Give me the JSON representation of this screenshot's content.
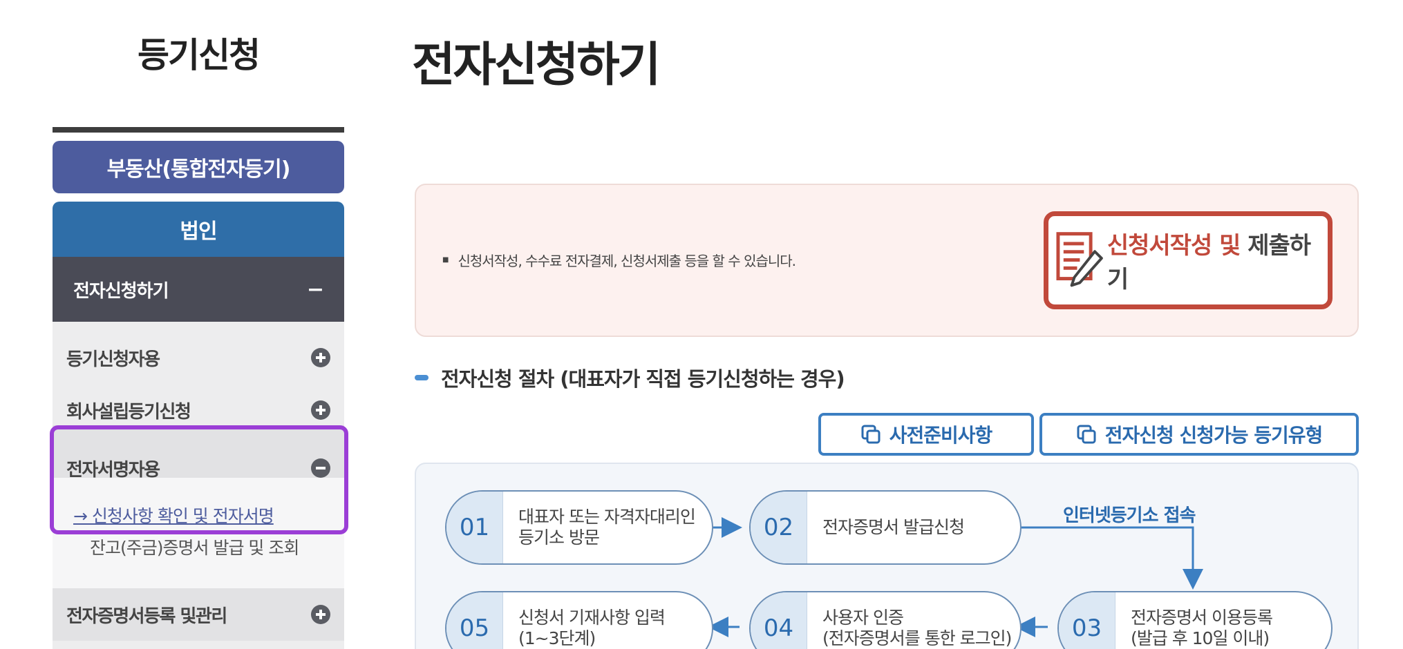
{
  "sidebar": {
    "title": "등기신청",
    "primary_menu": "부동산(통합전자등기)",
    "corp_menu": "법인",
    "active_submenu": "전자신청하기",
    "items": [
      {
        "label": "등기신청자용"
      },
      {
        "label": "회사설립등기신청"
      },
      {
        "label": "전자서명자용"
      },
      {
        "label": "전자증명서등록 및관리"
      }
    ],
    "children": [
      {
        "label": "→ 신청사항 확인 및 전자서명"
      },
      {
        "label": "잔고(주금)증명서 발급 및 조회"
      }
    ]
  },
  "main": {
    "page_title": "전자신청하기",
    "info_text": "신청서작성, 수수료 전자결제, 신청서제출 등을 할 수 있습니다.",
    "apply_button": {
      "part1": "신청서작성 및",
      "part2": "제출하기"
    },
    "section_title": "전자신청 절차 (대표자가 직접 등기신청하는 경우)",
    "links": [
      "사전준비사항",
      "전자신청 신청가능 등기유형"
    ],
    "flow_note": "인터넷등기소 접속",
    "steps": [
      {
        "num": "01",
        "text": "대표자 또는 자격자대리인\n등기소 방문"
      },
      {
        "num": "02",
        "text": "전자증명서 발급신청"
      },
      {
        "num": "03",
        "text": "전자증명서 이용등록\n(발급 후 10일 이내)"
      },
      {
        "num": "04",
        "text": "사용자 인증\n(전자증명서를 통한 로그인)"
      },
      {
        "num": "05",
        "text": "신청서 기재사항 입력\n(1~3단계)"
      }
    ]
  },
  "colors": {
    "primary": "#4d5c9e",
    "corp": "#2f6ea8",
    "accent_red": "#c1493b",
    "link_blue": "#2a6aae",
    "highlight": "#9b3ed6"
  }
}
